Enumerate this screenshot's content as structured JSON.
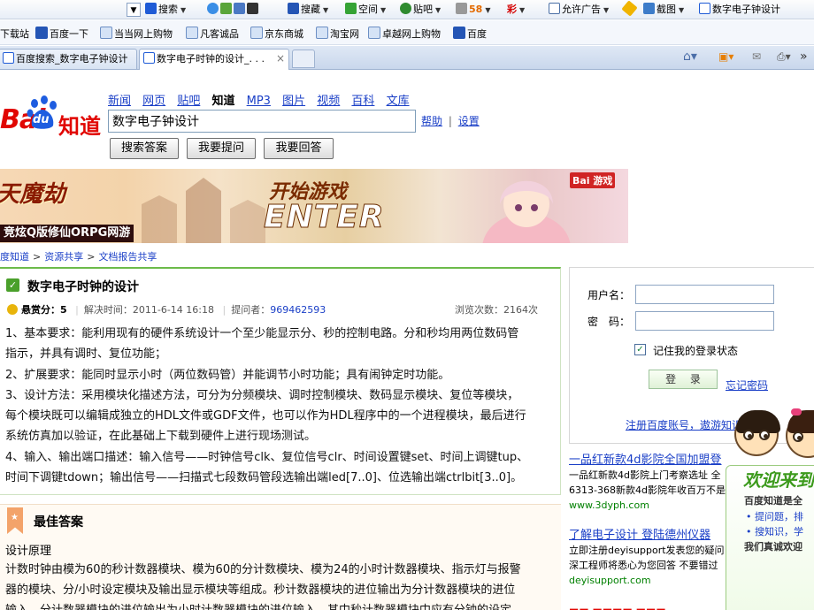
{
  "browser": {
    "toolbar": {
      "search_label": "搜索",
      "items": [
        "搜藏",
        "空间",
        "贴吧",
        "58",
        "彩"
      ],
      "popup_allow": "允许广告",
      "screenshot": "截图",
      "page_label": "数字电子钟设计"
    },
    "favorites": [
      "下载站",
      "百度一下",
      "当当网上购物",
      "凡客诚品",
      "京东商城",
      "淘宝网",
      "卓越网上购物",
      "百度"
    ],
    "tabs": [
      {
        "label": "百度搜索_数字电子钟设计",
        "active": false
      },
      {
        "label": "数字电子时钟的设计_. . .",
        "active": true
      }
    ],
    "tab_close": "×"
  },
  "header": {
    "logo_bai": "Bai",
    "logo_du": "du",
    "logo_zhidao": "知道",
    "nav": [
      "新闻",
      "网页",
      "贴吧",
      "知道",
      "MP3",
      "图片",
      "视频",
      "百科",
      "文库"
    ],
    "nav_current": "知道",
    "search_value": "数字电子钟设计",
    "help": "帮助",
    "settings": "设置",
    "help_sep": "|",
    "buttons": {
      "search": "搜索答案",
      "ask": "我要提问",
      "answer": "我要回答"
    }
  },
  "banner": {
    "title": "天魔劫",
    "tag": "竞炫Q版修仙ORPG网游",
    "start": "开始游戏",
    "enter": "ENTER",
    "badge": "Bai 游戏"
  },
  "breadcrumb": [
    "度知道",
    "资源共享",
    "文档报告共享"
  ],
  "question": {
    "title": "数字电子时钟的设计",
    "reward_label": "悬赏分：",
    "reward": "5",
    "solved_label": "解决时间：",
    "solved_time": "2011-6-14 16:18",
    "asker_label": "提问者：",
    "asker": "969462593",
    "views": "浏览次数：2164次",
    "body": [
      "1、基本要求：能利用现有的硬件系统设计一个至少能显示分、秒的控制电路。分和秒均用两位数码管",
      "指示，并具有调时、复位功能；",
      "2、扩展要求：能同时显示小时（两位数码管）并能调节小时功能；具有闹钟定时功能。",
      "3、设计方法：采用模块化描述方法，可分为分频模块、调时控制模块、数码显示模块、复位等模块，",
      "每个模块既可以编辑成独立的HDL文件或GDF文件，也可以作为HDL程序中的一个进程模块，最后进行",
      "系统仿真加以验证，在此基础上下载到硬件上进行现场测试。",
      "4、输入、输出端口描述：输入信号——时钟信号clk、复位信号clr、时间设置键set、时间上调键tup、",
      "时间下调键tdown；输出信号——扫描式七段数码管段选输出端led[7..0]、位选输出端ctrlbit[3..0]。"
    ]
  },
  "answer": {
    "title": "最佳答案",
    "subtitle": "设计原理",
    "body": [
      "计数时钟由模为60的秒计数器模块、模为60的分计数模块、模为24的小时计数器模块、指示灯与报警",
      "器的模块、分/小时设定模块及输出显示模块等组成。秒计数器模块的进位输出为分计数器模块的进位",
      "输入，分计数器模块的进位输出为小时计数器模块的进位输入。其中秒计数器模块中应有分钟的设定，"
    ]
  },
  "login": {
    "username_label": "用户名：",
    "password_label": "密　码：",
    "remember": "记住我的登录状态",
    "remember_checked": "✓",
    "login_button": "登 录",
    "forgot": "忘记密码",
    "register": "注册百度账号，遨游知识"
  },
  "ads": [
    {
      "title": "一品红新款4d影院全国加盟登",
      "lines": [
        "一品红新款4d影院上门考察选址 全",
        "6313-368新款4d影院年收百万不是"
      ],
      "url": "www.3dyph.com"
    },
    {
      "title": "了解电子设计 登陆德州仪器",
      "lines": [
        "立即注册deyisupport发表您的疑问",
        "深工程师将悉心为您回答 不要错过"
      ],
      "url": "deyisupport.com"
    }
  ],
  "popup": {
    "title": "欢迎来到",
    "line1": "百度知道是全",
    "line2": "• 提问题，排",
    "line3": "• 搜知识，学",
    "line4": "我们真诚欢迎"
  }
}
